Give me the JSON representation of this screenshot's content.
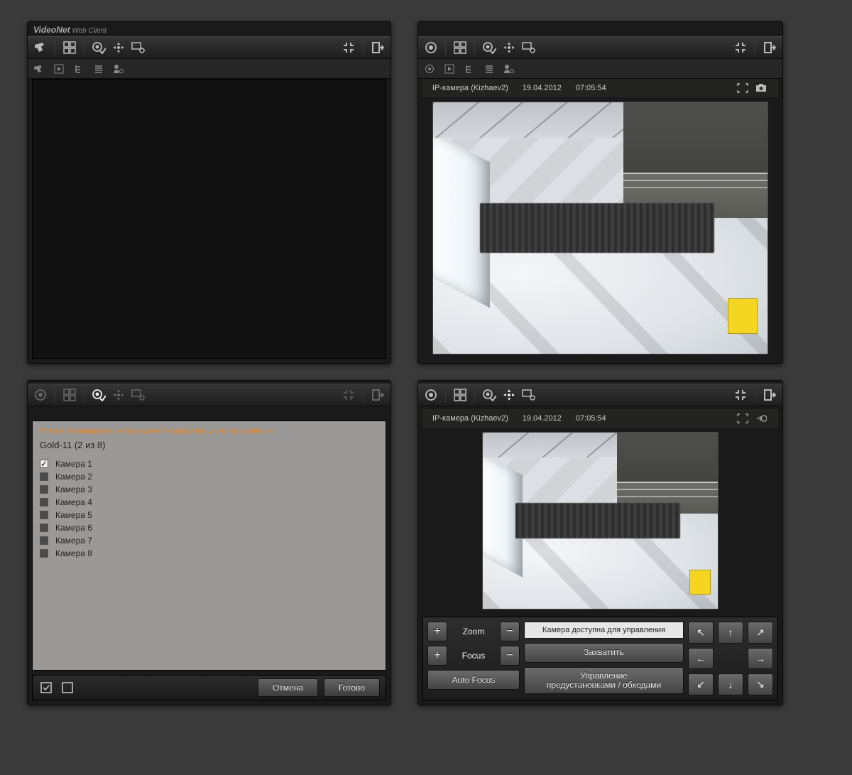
{
  "brand": {
    "name": "VideoNet",
    "sub": "Web Client"
  },
  "camera_meta": {
    "name": "IP-камера (Kizhaev2)",
    "date": "19.04.2012",
    "time": "07:05:54"
  },
  "bl": {
    "hint": "Отметьте камеры по которым необходимо получить трансляцию",
    "server": "Gold-11 (2 из 8)",
    "cameras": [
      {
        "label": "Камера 1",
        "checked": true
      },
      {
        "label": "Камера 2",
        "checked": false
      },
      {
        "label": "Камера 3",
        "checked": false
      },
      {
        "label": "Камера 4",
        "checked": false
      },
      {
        "label": "Камера 5",
        "checked": false
      },
      {
        "label": "Камера 6",
        "checked": false
      },
      {
        "label": "Камера 7",
        "checked": false
      },
      {
        "label": "Камера 8",
        "checked": false
      }
    ],
    "cancel": "Отмена",
    "done": "Готово"
  },
  "ptz": {
    "zoom": "Zoom",
    "focus": "Focus",
    "autofocus": "Auto Focus",
    "status": "Камера доступна для управления",
    "capture": "Захватить",
    "presets": "Управление\nпредустановками / обходами"
  }
}
